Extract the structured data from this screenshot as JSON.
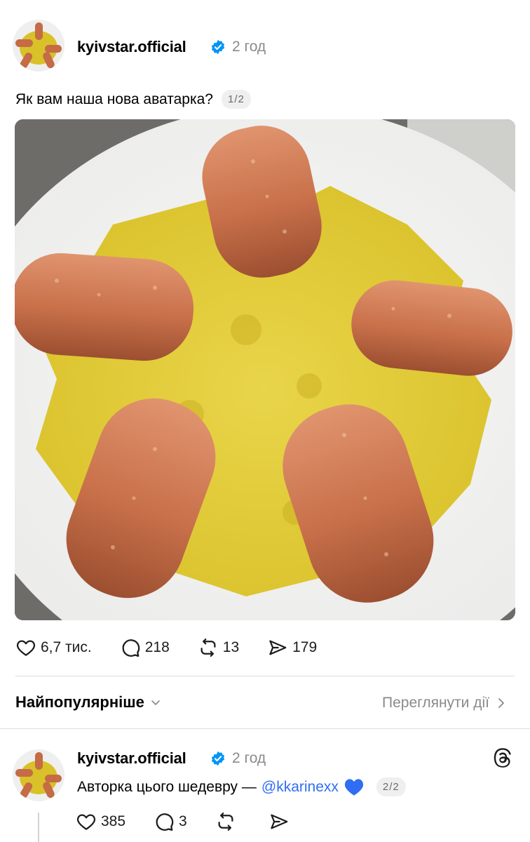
{
  "post": {
    "username": "kyivstar.official",
    "time": "2 год",
    "caption": "Як вам наша нова аватарка?",
    "pager": "1/2",
    "image_alt": "plate of yellow mashed potatoes with five sausages arranged like a star",
    "stats": {
      "likes": "6,7 тис.",
      "comments": "218",
      "reposts": "13",
      "shares": "179"
    }
  },
  "sort_bar": {
    "label": "Найпопулярніше",
    "view_activity": "Переглянути дії"
  },
  "reply": {
    "username": "kyivstar.official",
    "time": "2 год",
    "text": "Авторка цього шедевру —",
    "mention": "@kkarinexx",
    "pager": "2/2",
    "stats": {
      "likes": "385",
      "comments": "3"
    }
  },
  "colors": {
    "verified": "#0095f6",
    "mention": "#2f6ef2",
    "heart": "#2f6ef2",
    "muted": "#8a8a8a"
  },
  "icons": [
    "heart-icon",
    "comment-icon",
    "repost-icon",
    "share-icon",
    "verified-icon",
    "chevron-down-icon",
    "chevron-right-icon",
    "threads-logo-icon"
  ]
}
